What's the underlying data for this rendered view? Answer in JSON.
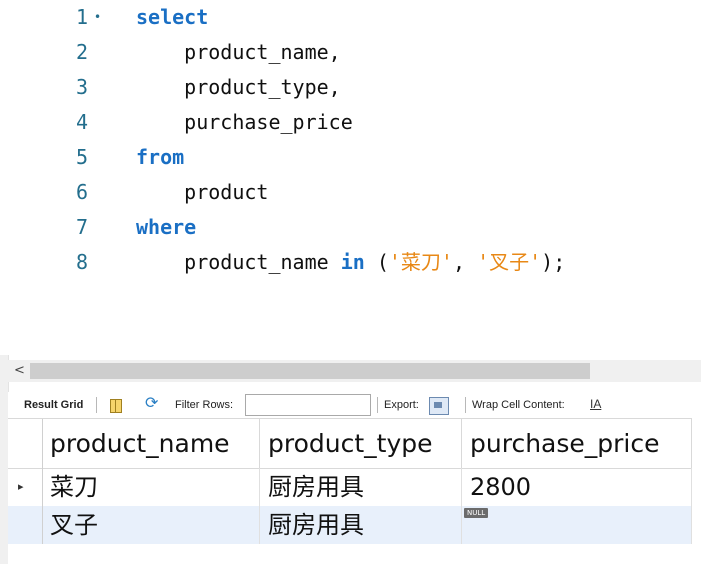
{
  "editor": {
    "lines": [
      {
        "num": "1",
        "has_fold": true,
        "tokens": [
          {
            "t": "select",
            "c": "kw"
          }
        ]
      },
      {
        "num": "2",
        "has_fold": false,
        "tokens": [
          {
            "t": "    product_name,",
            "c": ""
          }
        ]
      },
      {
        "num": "3",
        "has_fold": false,
        "tokens": [
          {
            "t": "    product_type,",
            "c": ""
          }
        ]
      },
      {
        "num": "4",
        "has_fold": false,
        "tokens": [
          {
            "t": "    purchase_price",
            "c": ""
          }
        ]
      },
      {
        "num": "5",
        "has_fold": false,
        "tokens": [
          {
            "t": "from",
            "c": "kw"
          }
        ]
      },
      {
        "num": "6",
        "has_fold": false,
        "tokens": [
          {
            "t": "    product",
            "c": ""
          }
        ]
      },
      {
        "num": "7",
        "has_fold": false,
        "tokens": [
          {
            "t": "where",
            "c": "kw"
          }
        ]
      },
      {
        "num": "8",
        "has_fold": false,
        "tokens": [
          {
            "t": "    product_name ",
            "c": ""
          },
          {
            "t": "in",
            "c": "kw"
          },
          {
            "t": " (",
            "c": ""
          },
          {
            "t": "'菜刀'",
            "c": "str"
          },
          {
            "t": ", ",
            "c": ""
          },
          {
            "t": "'叉子'",
            "c": "str"
          },
          {
            "t": ");",
            "c": ""
          }
        ]
      }
    ],
    "fold_glyph": "•"
  },
  "scrollbar": {
    "left_arrow": "<"
  },
  "toolbar": {
    "result_grid_label": "Result Grid",
    "filter_rows_label": "Filter Rows:",
    "filter_value": "",
    "export_label": "Export:",
    "wrap_label": "Wrap Cell Content:",
    "wrap_icon_glyph": "IA"
  },
  "grid": {
    "columns": [
      "product_name",
      "product_type",
      "purchase_price"
    ],
    "current_row_marker": "▸",
    "rows": [
      {
        "product_name": "菜刀",
        "product_type": "厨房用具",
        "purchase_price": "2800",
        "is_null_price": false
      },
      {
        "product_name": "叉子",
        "product_type": "厨房用具",
        "purchase_price": "NULL",
        "is_null_price": true
      }
    ]
  }
}
